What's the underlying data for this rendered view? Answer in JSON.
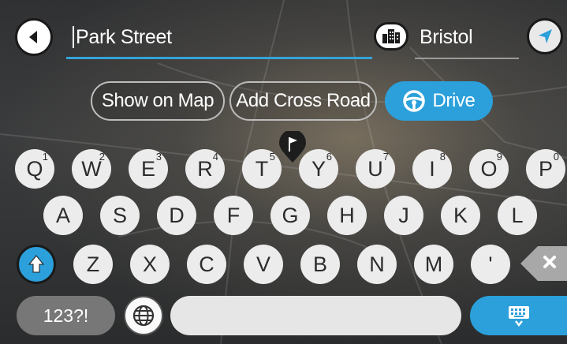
{
  "search": {
    "query": "Park Street",
    "city": "Bristol"
  },
  "actions": {
    "show_on_map": "Show on Map",
    "add_cross_road": "Add Cross Road",
    "drive": "Drive"
  },
  "keyboard": {
    "row1": [
      {
        "key": "Q",
        "sup": "1"
      },
      {
        "key": "W",
        "sup": "2"
      },
      {
        "key": "E",
        "sup": "3"
      },
      {
        "key": "R",
        "sup": "4"
      },
      {
        "key": "T",
        "sup": "5"
      },
      {
        "key": "Y",
        "sup": "6"
      },
      {
        "key": "U",
        "sup": "7"
      },
      {
        "key": "I",
        "sup": "8"
      },
      {
        "key": "O",
        "sup": "9"
      },
      {
        "key": "P",
        "sup": "0"
      }
    ],
    "row2": [
      "A",
      "S",
      "D",
      "F",
      "G",
      "H",
      "J",
      "K",
      "L"
    ],
    "row3": [
      "Z",
      "X",
      "C",
      "V",
      "B",
      "N",
      "M",
      "'"
    ],
    "numbers_label": "123?!"
  },
  "colors": {
    "accent": "#2ba0db",
    "key_bg": "#ececec"
  },
  "icons": [
    "back-arrow-icon",
    "city-icon",
    "navigation-arrow-icon",
    "steering-wheel-icon",
    "flag-pin-icon",
    "shift-arrow-icon",
    "backspace-icon",
    "globe-icon",
    "keyboard-hide-icon"
  ]
}
